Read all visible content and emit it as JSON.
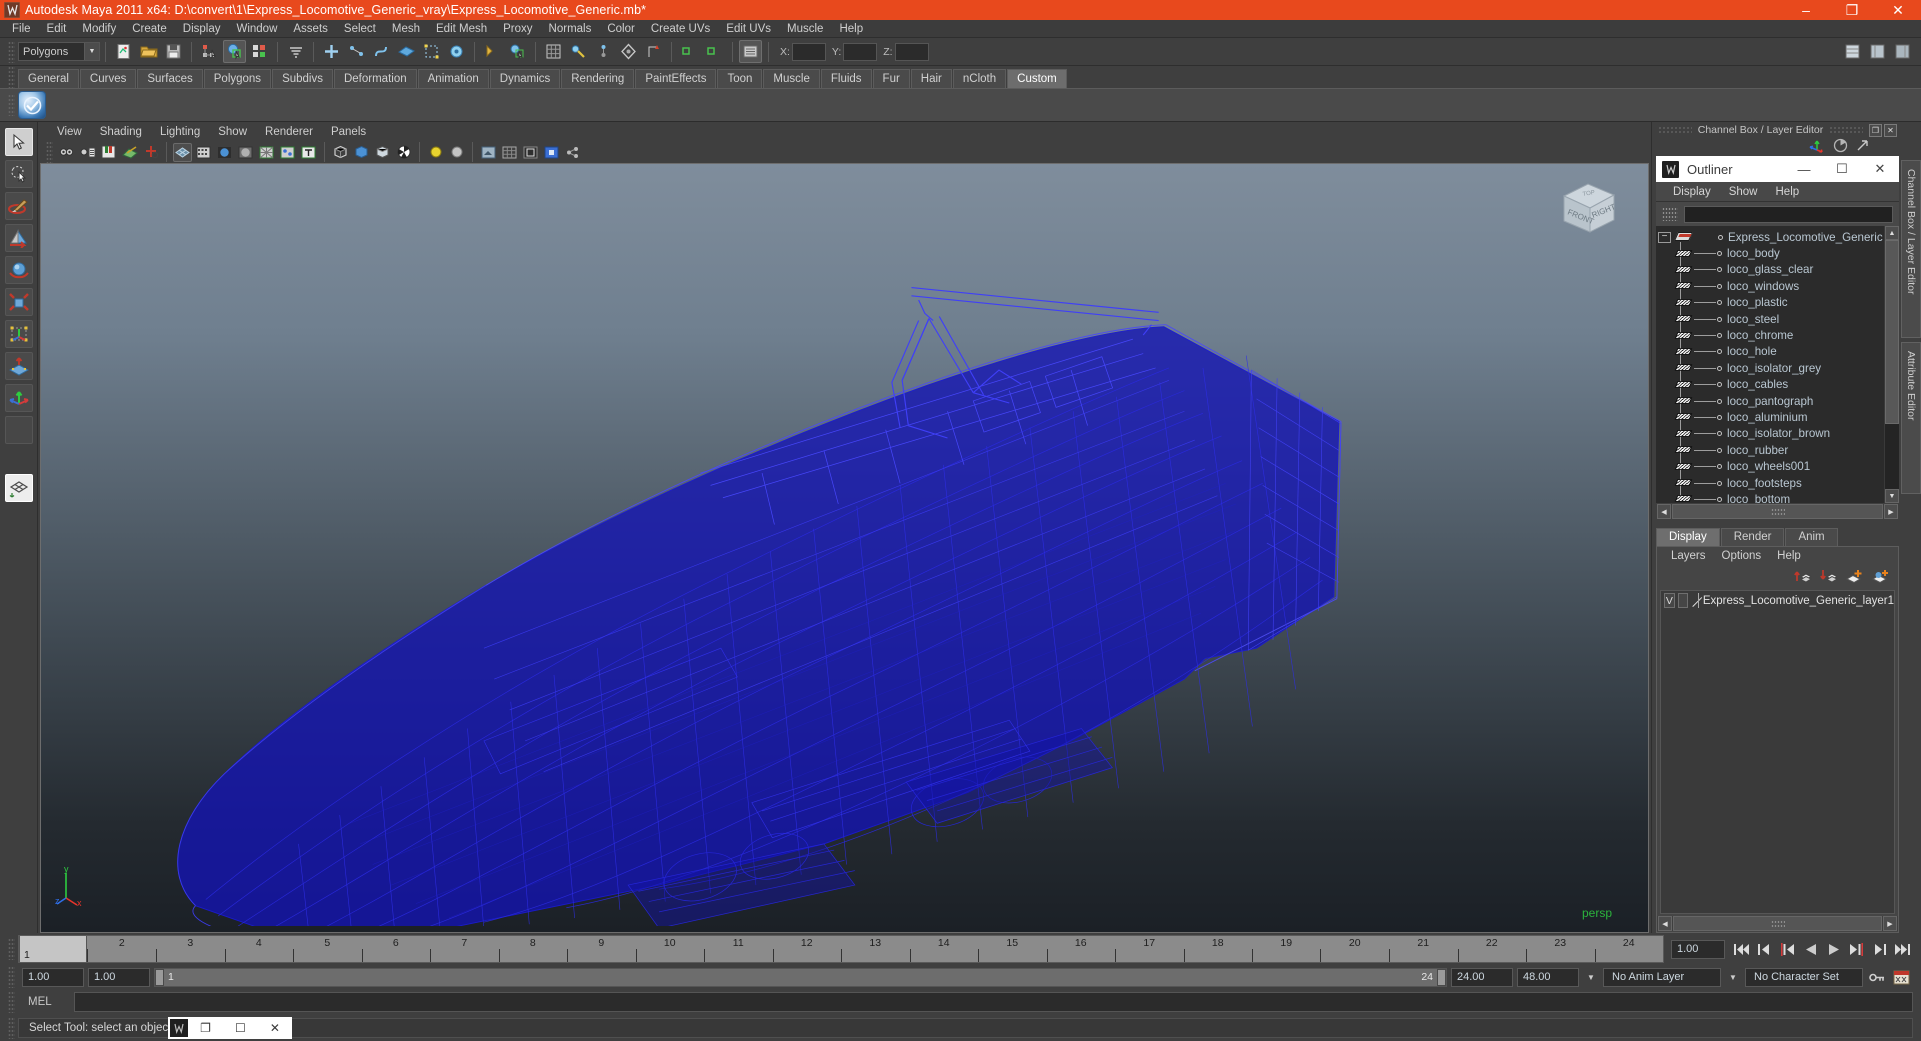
{
  "window": {
    "title": "Autodesk Maya 2011 x64: D:\\convert\\1\\Express_Locomotive_Generic_vray\\Express_Locomotive_Generic.mb*",
    "minimize": "–",
    "maximize": "❐",
    "close": "✕",
    "app_icon": "maya-logo-icon"
  },
  "menubar": {
    "items": [
      "File",
      "Edit",
      "Modify",
      "Create",
      "Display",
      "Window",
      "Assets",
      "Select",
      "Mesh",
      "Edit Mesh",
      "Proxy",
      "Normals",
      "Color",
      "Create UVs",
      "Edit UVs",
      "Muscle",
      "Help"
    ]
  },
  "toolbar": {
    "menuset": "Polygons",
    "axis_labels": [
      "X:",
      "Y:",
      "Z:"
    ],
    "axis_values": [
      "",
      "",
      ""
    ]
  },
  "shelf": {
    "tabs": [
      "General",
      "Curves",
      "Surfaces",
      "Polygons",
      "Subdivs",
      "Deformation",
      "Animation",
      "Dynamics",
      "Rendering",
      "PaintEffects",
      "Toon",
      "Muscle",
      "Fluids",
      "Fur",
      "Hair",
      "nCloth",
      "Custom"
    ],
    "active_tab": "Custom",
    "items": [
      {
        "icon": "blue-sphere-shelf-icon"
      }
    ]
  },
  "toolbox": {
    "tools": [
      {
        "name": "select-tool",
        "active": true
      },
      {
        "name": "lasso-select-tool",
        "active": false
      },
      {
        "name": "paint-select-tool",
        "active": false
      },
      {
        "name": "move-tool",
        "active": false
      },
      {
        "name": "rotate-tool",
        "active": false
      },
      {
        "name": "scale-tool",
        "active": false
      },
      {
        "name": "universal-manipulator-tool",
        "active": false
      },
      {
        "name": "soft-modification-tool",
        "active": false
      },
      {
        "name": "show-manipulator-tool",
        "active": false
      },
      {
        "name": "last-used-tool",
        "active": false
      }
    ]
  },
  "viewport": {
    "menu": [
      "View",
      "Shading",
      "Lighting",
      "Show",
      "Renderer",
      "Panels"
    ],
    "camera_label": "persp",
    "axis": {
      "x": "x",
      "y": "y",
      "z": "z"
    },
    "viewcube": {
      "front": "FRONT",
      "right": "RIGHT",
      "top": "TOP"
    },
    "model_name": "Express_Locomotive_Generic wireframe",
    "wire_color": "#1414c8",
    "bg_top": "#7f8d9c",
    "bg_bottom": "#1b2026"
  },
  "channel_box": {
    "header": "Channel Box / Layer Editor",
    "restore_icon": "❐",
    "close_icon": "✕"
  },
  "outliner": {
    "title": "Outliner",
    "window_buttons": {
      "minimize": "—",
      "maximize": "☐",
      "close": "✕"
    },
    "menu": [
      "Display",
      "Show",
      "Help"
    ],
    "search_value": "",
    "search_placeholder": "",
    "root": "Express_Locomotive_Generic",
    "children": [
      "loco_body",
      "loco_glass_clear",
      "loco_windows",
      "loco_plastic",
      "loco_steel",
      "loco_chrome",
      "loco_hole",
      "loco_isolator_grey",
      "loco_cables",
      "loco_pantograph",
      "loco_aluminium",
      "loco_isolator_brown",
      "loco_rubber",
      "loco_wheels001",
      "loco_footsteps",
      "loco_bottom"
    ]
  },
  "layer_editor": {
    "tabs": [
      "Display",
      "Render",
      "Anim"
    ],
    "active_tab": "Display",
    "menu": [
      "Layers",
      "Options",
      "Help"
    ],
    "buttons": [
      "move-layer-up-icon",
      "move-layer-down-icon",
      "new-layer-icon",
      "new-layer-from-selected-icon"
    ],
    "layers": [
      {
        "visibility": "V",
        "playback": "",
        "name": "Express_Locomotive_Generic_layer1"
      }
    ]
  },
  "side_tabs": {
    "items": [
      "Channel Box / Layer Editor",
      "Attribute Editor"
    ]
  },
  "timeslider": {
    "ticks": [
      "1",
      "2",
      "3",
      "4",
      "5",
      "6",
      "7",
      "8",
      "9",
      "10",
      "11",
      "12",
      "13",
      "14",
      "15",
      "16",
      "17",
      "18",
      "19",
      "20",
      "21",
      "22",
      "23",
      "24"
    ],
    "current_frame_label": "1",
    "current_time": "1.00",
    "playback_buttons": [
      "go-to-start-icon",
      "step-back-keyframe-icon",
      "step-back-frame-icon",
      "play-backwards-icon",
      "play-forwards-icon",
      "step-forward-frame-icon",
      "step-forward-keyframe-icon",
      "go-to-end-icon"
    ]
  },
  "rangeslider": {
    "anim_start": "1.00",
    "range_start": "1.00",
    "range_bar_left": "1",
    "range_bar_right": "24",
    "range_end": "24.00",
    "anim_end": "48.00",
    "anim_layer": "No Anim Layer",
    "character_set": "No Character Set",
    "right_icons": [
      "auto-key-icon",
      "animation-preferences-icon"
    ]
  },
  "mel": {
    "label": "MEL",
    "command_value": ""
  },
  "status": {
    "message": "Select Tool: select an object"
  },
  "popup": {
    "icon": "maya-logo-icon",
    "restore": "❐",
    "maximize": "☐",
    "close": "✕"
  }
}
